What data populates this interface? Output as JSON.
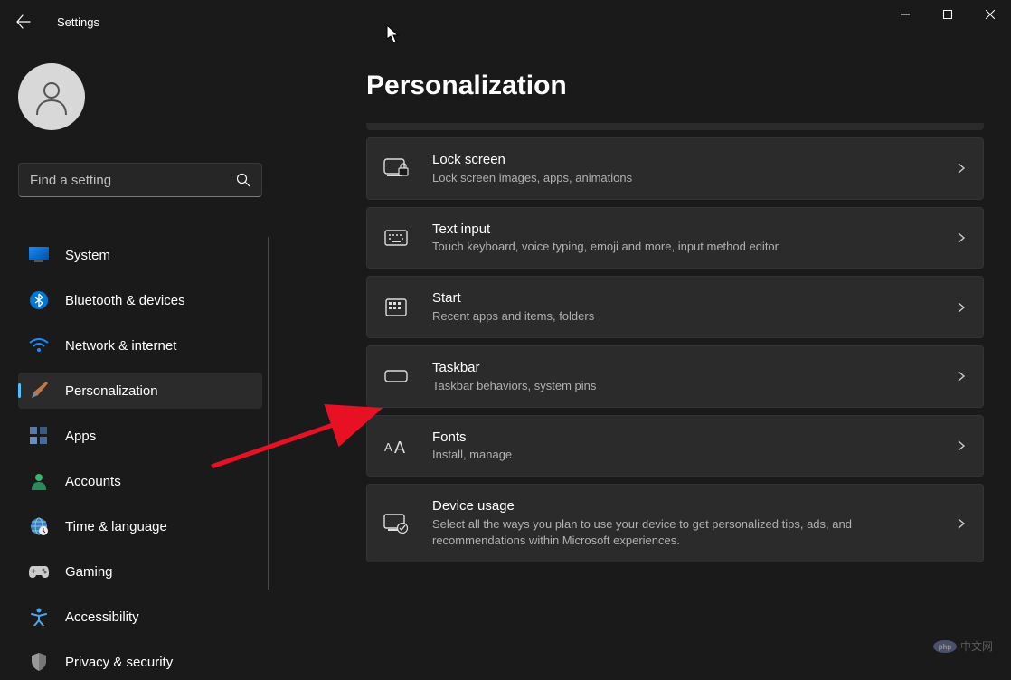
{
  "window": {
    "title": "Settings",
    "search_placeholder": "Find a setting"
  },
  "page": {
    "title": "Personalization"
  },
  "nav": [
    {
      "id": "system",
      "label": "System",
      "icon": "monitor",
      "active": false
    },
    {
      "id": "bluetooth",
      "label": "Bluetooth & devices",
      "icon": "bluetooth",
      "active": false
    },
    {
      "id": "network",
      "label": "Network & internet",
      "icon": "wifi",
      "active": false
    },
    {
      "id": "personalization",
      "label": "Personalization",
      "icon": "brush",
      "active": true
    },
    {
      "id": "apps",
      "label": "Apps",
      "icon": "apps",
      "active": false
    },
    {
      "id": "accounts",
      "label": "Accounts",
      "icon": "person",
      "active": false
    },
    {
      "id": "time-language",
      "label": "Time & language",
      "icon": "globe",
      "active": false
    },
    {
      "id": "gaming",
      "label": "Gaming",
      "icon": "gamepad",
      "active": false
    },
    {
      "id": "accessibility",
      "label": "Accessibility",
      "icon": "accessibility",
      "active": false
    },
    {
      "id": "privacy",
      "label": "Privacy & security",
      "icon": "shield",
      "active": false
    }
  ],
  "settings": [
    {
      "id": "lock-screen",
      "title": "Lock screen",
      "desc": "Lock screen images, apps, animations",
      "icon": "lock-screen"
    },
    {
      "id": "text-input",
      "title": "Text input",
      "desc": "Touch keyboard, voice typing, emoji and more, input method editor",
      "icon": "keyboard"
    },
    {
      "id": "start",
      "title": "Start",
      "desc": "Recent apps and items, folders",
      "icon": "start"
    },
    {
      "id": "taskbar",
      "title": "Taskbar",
      "desc": "Taskbar behaviors, system pins",
      "icon": "taskbar"
    },
    {
      "id": "fonts",
      "title": "Fonts",
      "desc": "Install, manage",
      "icon": "fonts"
    },
    {
      "id": "device-usage",
      "title": "Device usage",
      "desc": "Select all the ways you plan to use your device to get personalized tips, ads, and recommendations within Microsoft experiences.",
      "icon": "device-usage"
    }
  ],
  "watermark": "中文网",
  "colors": {
    "accent": "#4cc2ff",
    "bg": "#1a1a1a",
    "card": "#2b2b2b"
  }
}
